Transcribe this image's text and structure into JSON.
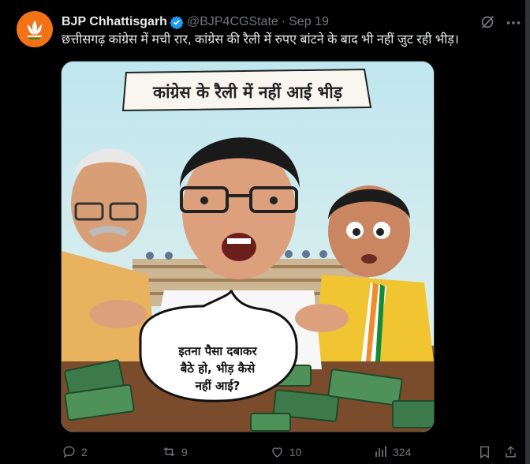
{
  "account": {
    "name": "BJP Chhattisgarh",
    "handle": "@BJP4CGState",
    "date": "Sep 19",
    "verified": true
  },
  "tweet": {
    "text": "छत्तीसगढ़ कांग्रेस में मची रार, कांग्रेस की रैली में रुपए बांटने के बाद भी नहीं जुट रही भीड़।"
  },
  "image": {
    "banner_text": "कांग्रेस के रैली में नहीं आई भीड़",
    "speech_lines": [
      "इतना पैसा दबाकर",
      "बैठे हो, भीड़ कैसे",
      "नहीं आई?"
    ]
  },
  "actions": {
    "replies": "2",
    "reposts": "9",
    "likes": "10",
    "views": "324"
  },
  "icons": [
    "verified-badge-icon",
    "grok-icon",
    "more-icon",
    "reply-icon",
    "repost-icon",
    "like-icon",
    "views-icon",
    "bookmark-icon",
    "share-icon"
  ],
  "colors": {
    "background": "#000000",
    "text": "#e7e9ea",
    "muted": "#71767b",
    "verified": "#1d9bf0",
    "bjp_orange": "#f47216"
  }
}
